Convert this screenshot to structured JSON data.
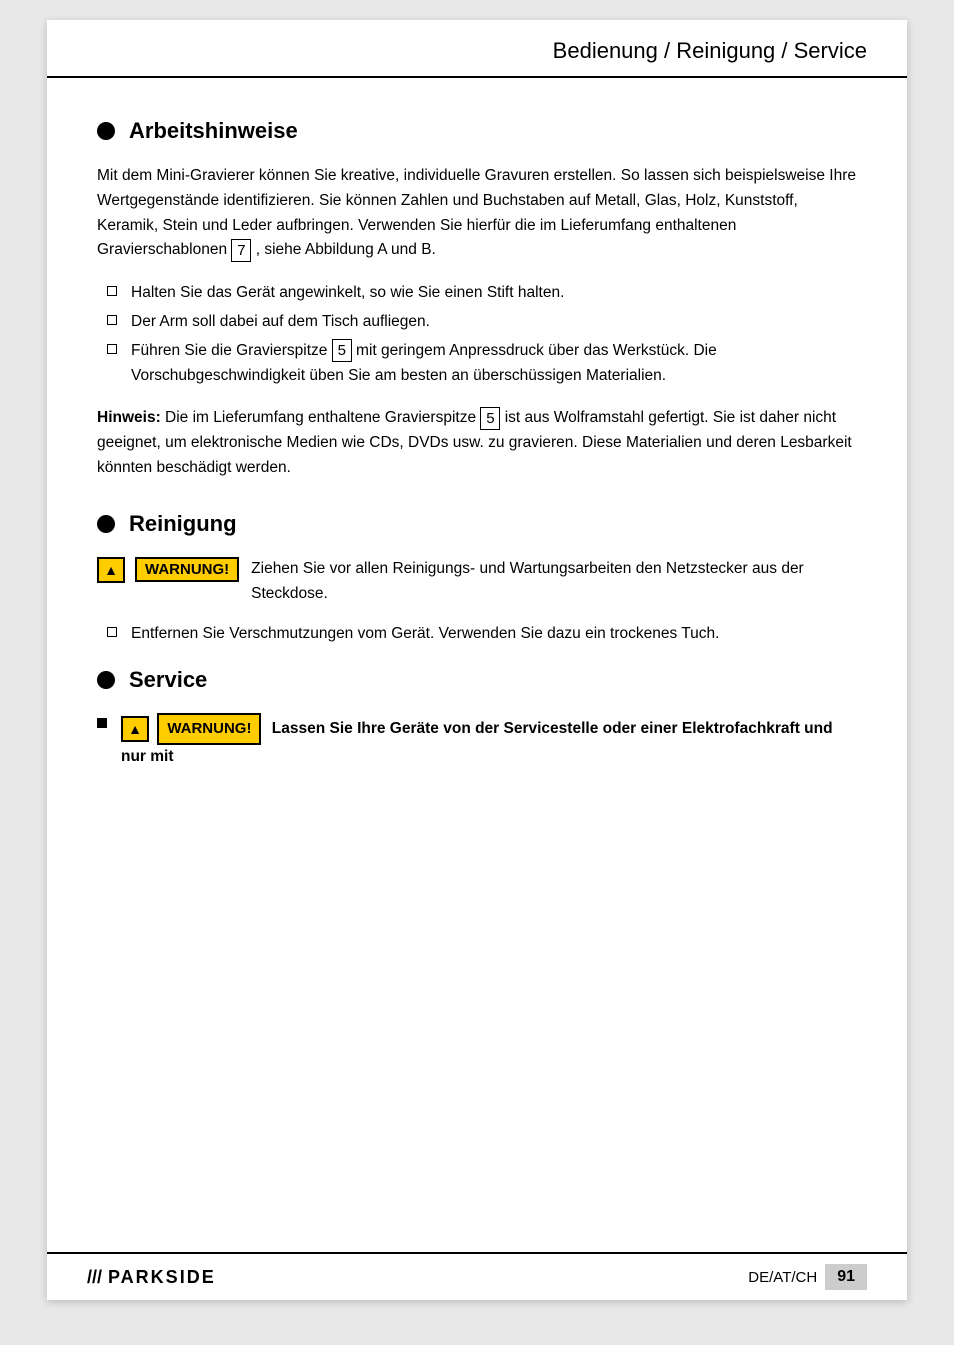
{
  "header": {
    "title": "Bedienung / Reinigung / Service"
  },
  "sections": {
    "arbeitshinweise": {
      "title": "Arbeitshinweise",
      "intro": "Mit dem Mini-Gravierer können Sie kreative, individuelle Gravuren erstellen. So lassen sich beispielsweise Ihre Wertgegenstände identifizieren. Sie können Zahlen und Buchstaben auf Metall, Glas, Holz, Kunststoff, Keramik, Stein und Leder aufbringen. Verwenden Sie hierfür die im Lieferumfang enthaltenen Gravierschablonen",
      "schablonen_num": "7",
      "intro_suffix": ", siehe Abbildung A und B.",
      "bullets": [
        "Halten Sie das Gerät angewinkelt, so wie Sie einen Stift halten.",
        "Der Arm soll dabei auf dem Tisch aufliegen.",
        "Führen Sie die Gravierspitze"
      ],
      "bullet3_num": "5",
      "bullet3_suffix": "mit geringem Anpressdruck über das Werkstück. Die Vorschubgeschwindigkeit üben Sie am besten an überschüssigen Materialien.",
      "hinweis_label": "Hinweis:",
      "hinweis_text": "Die im Lieferumfang enthaltene Gravierspitze",
      "hinweis_num": "5",
      "hinweis_suffix": "ist aus Wolframstahl gefertigt. Sie ist daher nicht geeignet, um elektronische Medien wie CDs, DVDs usw. zu gravieren. Diese Materialien und deren Lesbarkeit könnten beschädigt werden."
    },
    "reinigung": {
      "title": "Reinigung",
      "warnung_label": "WARNUNG!",
      "warnung_text": "Ziehen Sie vor allen Reinigungs- und Wartungsarbeiten den Netzstecker aus der Steckdose.",
      "bullet": "Entfernen Sie Verschmutzungen vom Gerät. Verwenden Sie dazu ein trockenes Tuch."
    },
    "service": {
      "title": "Service",
      "warnung_label": "WARNUNG!",
      "warnung_text": "Lassen Sie Ihre Geräte von der Servicestelle oder einer Elektrofachkraft und nur mit"
    }
  },
  "footer": {
    "logo_slashes": "///",
    "logo_text": "PARKSIDE",
    "locale": "DE/AT/CH",
    "page": "91"
  }
}
